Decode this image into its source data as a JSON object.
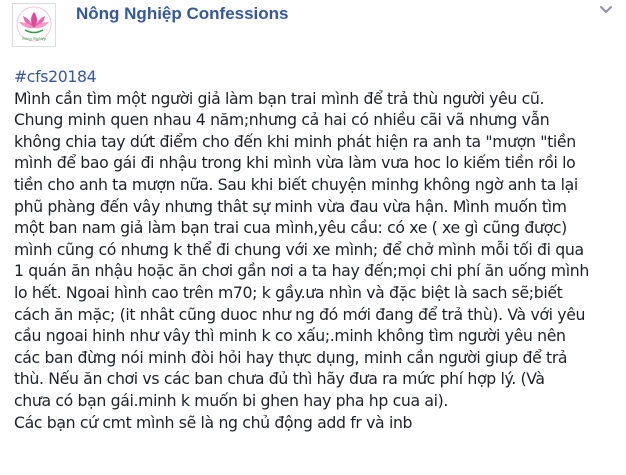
{
  "post": {
    "page_name": "Nông Nghiệp Confessions",
    "avatar_text": "Nông Nghiệp",
    "hashtag": "#cfs20184",
    "lines": [
      "Mình cần tìm một người giả làm bạn trai mình để trả thù người yêu cũ.",
      "Chung minh quen nhau 4 năm;nhưng cả hai có nhiều cãi vã nhưng vẫn",
      "không chia tay dứt điểm cho đến khi minh phát hiện ra anh ta \"mượn \"tiền",
      "mình để bao gái đi nhậu trong khi mình vừa làm vưa hoc lo kiếm tiền rồi lo",
      "tiền cho anh ta mượn nữa. Sau khi biết chuyện minhg không ngờ anh ta lại",
      "phũ phàng đến vây nhưng thât sự minh vừa đau vừa hận. Mình muốn tìm",
      "một ban nam giả làm bạn trai cua mình,yêu cầu: có xe ( xe gì cũng được)",
      "mình cũng có nhưng k thể đi chung với xe mình; để chở mình mỗi tối đi qua",
      "1 quán ăn nhậu hoặc ăn chơi gần nơi a ta hay đến;mọi chi phí ăn uống mình",
      "lo hết. Ngoai hình cao trên m70; k gầy.ưa nhìn và đặc biệt là sach sẽ;biết",
      "cách ăn mặc; (it nhât cũng duoc như ng đó mới đang để trả thù). Và với yêu",
      "cầu ngoai hinh như vây thì minh k co xấu;.minh không tìm người yêu nên",
      "các ban đừng nói minh đòi hỏi hay thực dụng, minh cần người giup để trả",
      "thù. Nếu ăn chơi vs các ban chưa đủ thì hãy đưa ra mức phí hợp lý. (Và",
      "chưa có bạn gái.minh k muốn bi ghen hay pha hp cua ai).",
      "Các bạn cứ cmt mình sẽ là ng chủ động add fr và inb"
    ]
  },
  "colors": {
    "link": "#365899",
    "text": "#1d2129",
    "logo_pink": "#e0479a",
    "logo_green": "#2f9a45",
    "chevron": "#90949c"
  },
  "icons": {
    "logo": "lotus-logo-icon",
    "menu": "chevron-down-icon"
  }
}
